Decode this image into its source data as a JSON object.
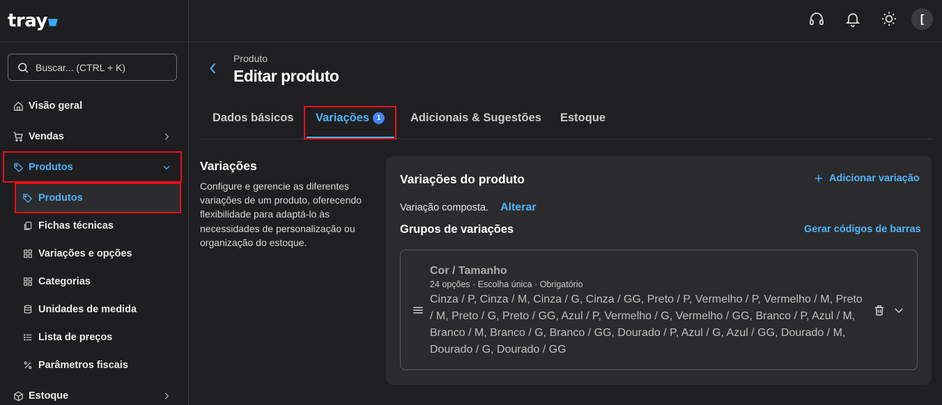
{
  "brand": {
    "logo": "tray"
  },
  "search": {
    "placeholder": "Buscar... (CTRL + K)"
  },
  "sidebar": {
    "items": [
      {
        "label": "Visão geral",
        "icon": "home-icon"
      },
      {
        "label": "Vendas",
        "icon": "cart-icon"
      },
      {
        "label": "Produtos",
        "icon": "tag-icon"
      },
      {
        "label": "Estoque",
        "icon": "box-icon"
      }
    ],
    "product_subitems": [
      {
        "label": "Produtos",
        "icon": "tag-icon"
      },
      {
        "label": "Fichas técnicas",
        "icon": "sheet-icon"
      },
      {
        "label": "Variações e opções",
        "icon": "grid-icon"
      },
      {
        "label": "Categorias",
        "icon": "grid-icon"
      },
      {
        "label": "Unidades de medida",
        "icon": "database-icon"
      },
      {
        "label": "Lista de preços",
        "icon": "list-icon"
      },
      {
        "label": "Parâmetros fiscais",
        "icon": "percent-icon"
      }
    ]
  },
  "topbar": {
    "avatar_initial": "["
  },
  "header": {
    "breadcrumb": "Produto",
    "title": "Editar produto"
  },
  "tabs": [
    {
      "label": "Dados básicos"
    },
    {
      "label": "Variações",
      "badge": "1"
    },
    {
      "label": "Adicionais & Sugestões"
    },
    {
      "label": "Estoque"
    }
  ],
  "section": {
    "title": "Variações",
    "description": "Configure e gerencie as diferentes variações de um produto, oferecendo flexibilidade para adaptá-lo às necessidades de personalização ou organização do estoque."
  },
  "card": {
    "title": "Variações do produto",
    "add_label": "Adicionar variação",
    "composition_text": "Variação composta.",
    "change_label": "Alterar",
    "groups_title": "Grupos de variações",
    "barcode_label": "Gerar códigos de barras",
    "group": {
      "title": "Cor / Tamanho",
      "meta": "24 opções · Escolha única · Obrigatório",
      "values": "Cinza / P, Cinza / M, Cinza / G, Cinza / GG, Preto / P, Vermelho / P, Vermelho / M, Preto / M, Preto / G, Preto / GG, Azul / P, Vermelho / G, Vermelho / GG, Branco / P, Azul / M, Branco / M, Branco / G, Branco / GG, Dourado / P, Azul / G, Azul / GG, Dourado / M, Dourado / G, Dourado / GG"
    }
  },
  "colors": {
    "accent": "#4fb3f6",
    "highlight": "#e8101a",
    "badge": "#3f82f0"
  }
}
